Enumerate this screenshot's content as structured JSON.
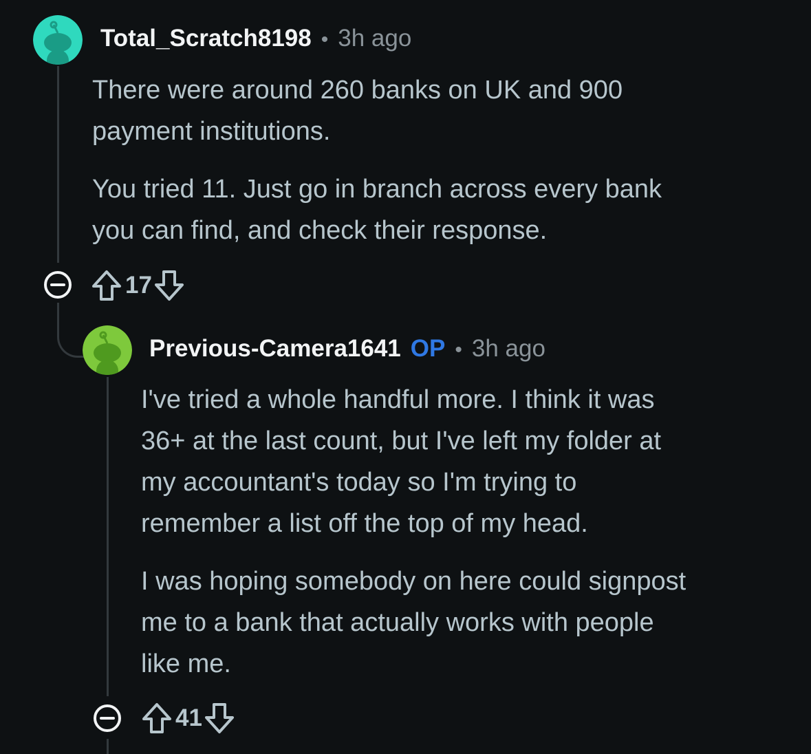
{
  "comments": [
    {
      "username": "Total_Scratch8198",
      "separator": "•",
      "time": "3h ago",
      "avatar_color": "#2fd9be",
      "paragraphs": [
        [
          "There were around 260 banks on UK and 900",
          "payment institutions."
        ],
        [
          "You tried 11. Just go in branch across every bank",
          "you can find, and check their response."
        ]
      ],
      "score": "17",
      "icons": [
        "collapse-icon",
        "upvote-icon",
        "downvote-icon"
      ]
    },
    {
      "username": "Previous-Camera1641",
      "op_badge": "OP",
      "separator": "•",
      "time": "3h ago",
      "avatar_color": "#7ec93c",
      "paragraphs": [
        [
          "I've tried a whole handful more. I think it was",
          "36+ at the last count, but I've left my folder at",
          "my accountant's today so I'm trying to",
          "remember a list off the top of my head."
        ],
        [
          "I was hoping somebody on here could signpost",
          "me to a bank that actually works with people",
          "like me."
        ]
      ],
      "score": "41",
      "icons": [
        "collapse-icon",
        "upvote-icon",
        "downvote-icon"
      ]
    }
  ],
  "colors": {
    "background": "#0e1113",
    "username": "#f2f4f5",
    "op": "#2f78e3",
    "meta": "#8a9399",
    "body_text": "#b7c6cd",
    "thread_line": "#33393d"
  }
}
